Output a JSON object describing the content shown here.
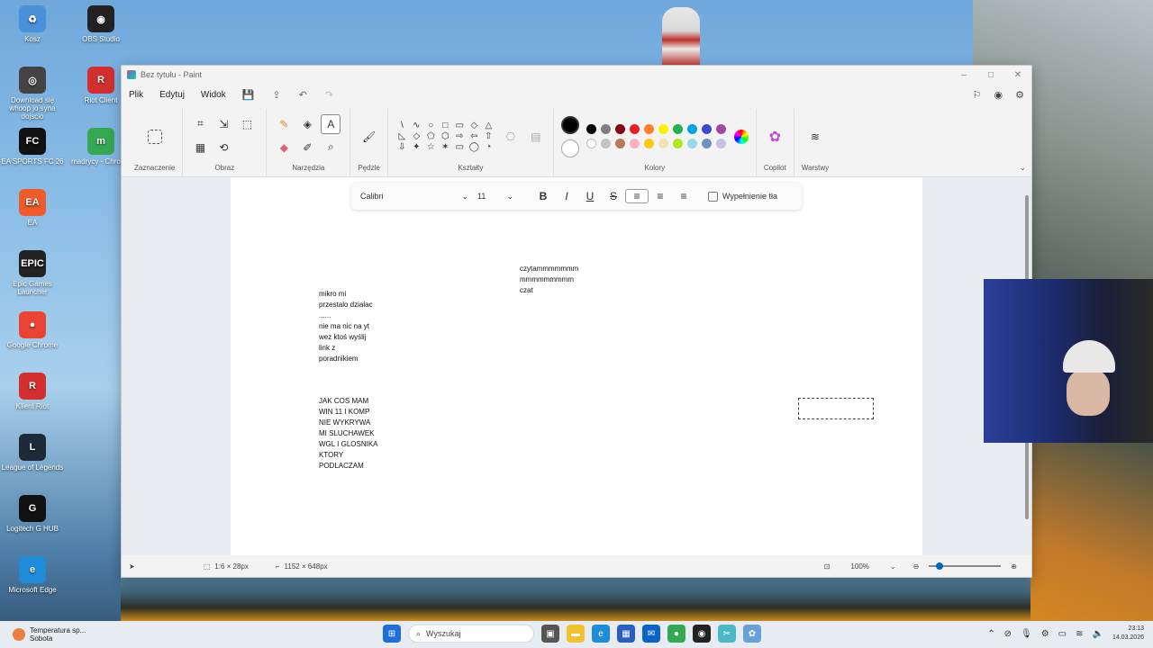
{
  "desktop": {
    "icons": [
      {
        "label": "Kosz",
        "glyph": "♻",
        "color": "#4a90d9"
      },
      {
        "label": "OBS Studio",
        "glyph": "◉",
        "color": "#222222"
      },
      {
        "label": "Download się whoop jo syna dojscio",
        "glyph": "◎",
        "color": "#444444"
      },
      {
        "label": "Riot Client",
        "glyph": "R",
        "color": "#d32f2f"
      },
      {
        "label": "EA SPORTS FC 26",
        "glyph": "FC",
        "color": "#111111"
      },
      {
        "label": "madrycy - Chrome",
        "glyph": "m",
        "color": "#34a853"
      },
      {
        "label": "EA",
        "glyph": "EA",
        "color": "#ef5b2b"
      },
      {
        "label": "Epic Games Launcher",
        "glyph": "EPIC",
        "color": "#222222"
      },
      {
        "label": "Google Chrome",
        "glyph": "●",
        "color": "#ea4335"
      },
      {
        "label": "Klient Riot",
        "glyph": "R",
        "color": "#d32f2f"
      },
      {
        "label": "League of Legends",
        "glyph": "L",
        "color": "#1e2a38"
      },
      {
        "label": "Logitech G HUB",
        "glyph": "G",
        "color": "#111111"
      },
      {
        "label": "Microsoft Edge",
        "glyph": "e",
        "color": "#1e8cd8"
      }
    ]
  },
  "window": {
    "title": "Bez tytułu - Paint",
    "controls": {
      "minimize": "–",
      "maximize": "□",
      "close": "✕"
    }
  },
  "menu": {
    "items": [
      "Plik",
      "Edytuj",
      "Widok"
    ],
    "save_icon": "save-icon",
    "share_icon": "share-icon",
    "undo_icon": "undo-icon",
    "redo_icon": "redo-icon"
  },
  "ribbon": {
    "groups": {
      "selection": "Zaznaczenie",
      "image": "Obraz",
      "tools": "Narzędzia",
      "brushes": "Pędzle",
      "shapes": "Kształty",
      "colors": "Kolory",
      "copilot": "Copilot",
      "layers": "Warstwy"
    },
    "shapes": [
      "\\",
      "∿",
      "○",
      "□",
      "▭",
      "◇",
      "△",
      "◺",
      "◇",
      "⬠",
      "⬡",
      "⇨",
      "⇦",
      "⇧",
      "⇩",
      "✦",
      "☆",
      "✶",
      "▭",
      "◯",
      "◔"
    ],
    "palette_row1": [
      "#000000",
      "#7f7f7f",
      "#880015",
      "#ed1c24",
      "#ff7f27",
      "#fff200",
      "#22b14c",
      "#00a2e8",
      "#3f48cc",
      "#a349a4"
    ],
    "palette_row2": [
      "empty",
      "#c3c3c3",
      "#b97a57",
      "#ffaec9",
      "#ffc90e",
      "#efe4b0",
      "#b5e61d",
      "#99d9ea",
      "#7092be",
      "#c8bfe7"
    ],
    "palette_row3": [
      "empty",
      "empty",
      "empty",
      "empty",
      "empty",
      "empty",
      "empty",
      "empty",
      "empty",
      "empty"
    ],
    "primary_color": "#000000",
    "secondary_color": "#ffffff"
  },
  "textbar": {
    "font": "Calibri",
    "size": "11",
    "bold": "B",
    "italic": "I",
    "underline": "U",
    "strike": "S",
    "fill_label": "Wypełnienie tła"
  },
  "canvas_notes": {
    "note1": "czytammmmmmm\nmmmmmmmmm\nczat",
    "note2": "mikro mi\nprzestalo dzialac\n......\nnie ma nic na yt\nwez ktoś wyślij\nlink z\nporadnikiem",
    "note3": "JAK COS MAM\nWIN 11 I KOMP\nNIE WYKRYWA\nMI SLUCHAWEK\nWGL I GLOSNIKA\nKTORY\nPODLACZAM"
  },
  "status": {
    "selection_size": "1:6 × 28px",
    "canvas_size": "1152 × 648px",
    "zoom": "100%"
  },
  "taskbar": {
    "weather_title": "Temperatura sp...",
    "weather_sub": "Sobota",
    "search_placeholder": "Wyszukaj",
    "time": "23:13",
    "date": "14.03.2026"
  }
}
